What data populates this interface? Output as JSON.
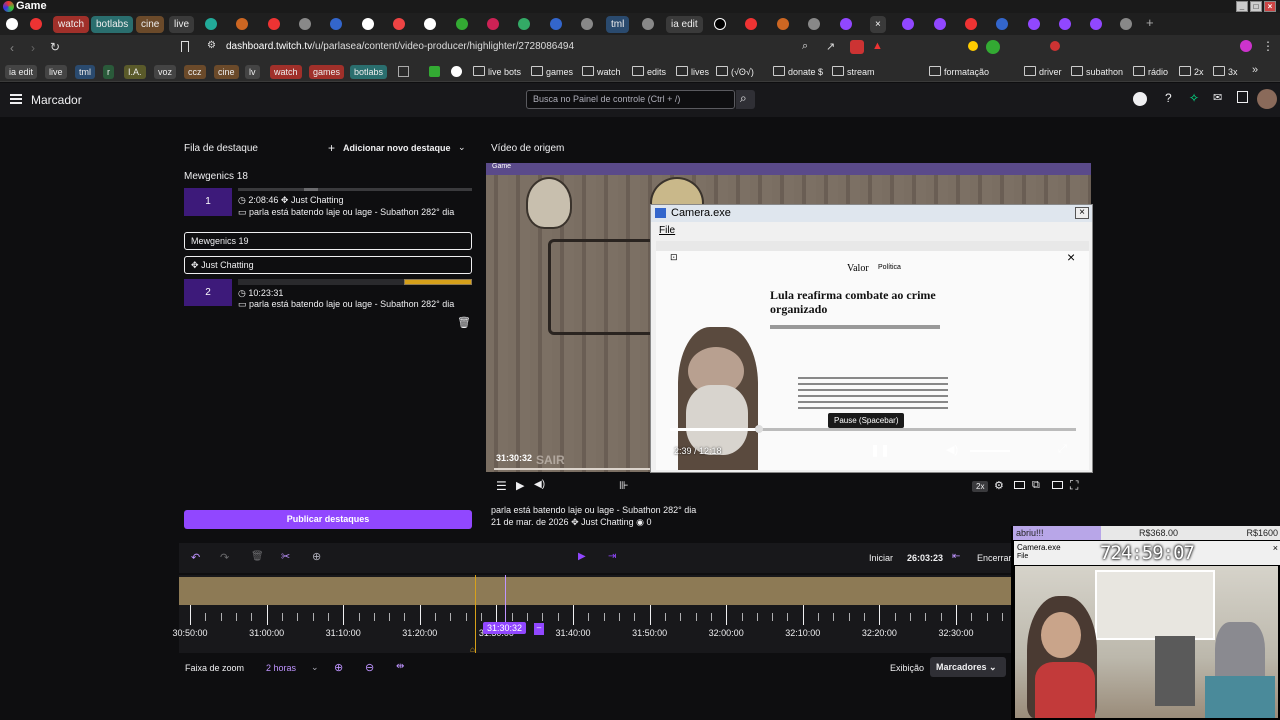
{
  "os": {
    "window_title": "Game"
  },
  "tabs": [
    {
      "label": "watch",
      "color": "#a0302a"
    },
    {
      "label": "botlabs",
      "color": "#2a6e6e"
    },
    {
      "label": "cine",
      "color": "#6b4a2a"
    },
    {
      "label": "live",
      "color": "#3a3a3a"
    },
    {
      "label": "tml",
      "color": "#2a4a6e"
    },
    {
      "label": "ia edit",
      "color": "#3a3a3a"
    }
  ],
  "address": {
    "domain": "dashboard.twitch.tv",
    "path": "/u/parlasea/content/video-producer/highlighter/2728086494"
  },
  "bookmarks": {
    "tags": [
      "ia edit",
      "live",
      "tml",
      "r",
      "I.A.",
      "voz",
      "ccz",
      "cine",
      "lv",
      "watch",
      "games",
      "botlabs"
    ],
    "folders": [
      "live bots",
      "games",
      "watch",
      "edits",
      "lives",
      "(√ʘ√)",
      "donate $",
      "stream",
      "formatação",
      "driver",
      "subathon",
      "rádio",
      "2x",
      "3x"
    ]
  },
  "topnav": {
    "title": "Marcador",
    "search_placeholder": "Busca no Painel de controle (Ctrl + /)"
  },
  "queue": {
    "title": "Fila de destaque",
    "add_label": "Adicionar novo destaque",
    "group1_title": "Mewgenics 18",
    "item1": {
      "number": "1",
      "time": "2:08:46",
      "category": "Just Chatting",
      "title": "parla está batendo laje ou lage - Subathon 282° dia"
    },
    "edit_title_value": "Mewgenics 19",
    "edit_category_value": "Just Chatting",
    "item2": {
      "number": "2",
      "time": "10:23:31",
      "title": "parla está batendo laje ou lage - Subathon 282° dia"
    },
    "publish_label": "Publicar destaques"
  },
  "source": {
    "title": "Vídeo de origem",
    "timestamp": "31:30:32",
    "video_title": "parla está batendo laje ou lage - Subathon 282° dia",
    "date": "21 de mar. de 2026",
    "category": "Just Chatting",
    "views": "0",
    "speed": "2x",
    "game_overlay": "Game"
  },
  "camera_window": {
    "caption": "Camera.exe",
    "menu_file": "File",
    "article_headline": "Lula reafirma combate ao crime organizado",
    "brand": "Valor",
    "section": "Política",
    "tooltip": "Pause (Spacebar)",
    "time": "2:39 / 12:18",
    "progress": 0.22
  },
  "timeline": {
    "start_label": "Iniciar",
    "start_value": "26:03:23",
    "end_label": "Encerrar",
    "playhead_label": "31:30:32",
    "ticks": [
      "30:50:00",
      "31:00:00",
      "31:10:00",
      "31:20:00",
      "31:30:00",
      "31:40:00",
      "31:50:00",
      "32:00:00",
      "32:10:00",
      "32:20:00",
      "32:30:00"
    ],
    "zoom_label": "Faixa de zoom",
    "zoom_value": "2 horas",
    "view_label": "Exibição",
    "markers_label": "Marcadores"
  },
  "overlay": {
    "name": "abriu!!!",
    "money_left": "R$368.00",
    "money_right": "R$1600",
    "window_caption": "Camera.exe",
    "file": "File",
    "clock": "724:59:07"
  },
  "colors": {
    "accent": "#9147ff",
    "background": "#0e0e10",
    "timeline": "#8d7a55"
  }
}
